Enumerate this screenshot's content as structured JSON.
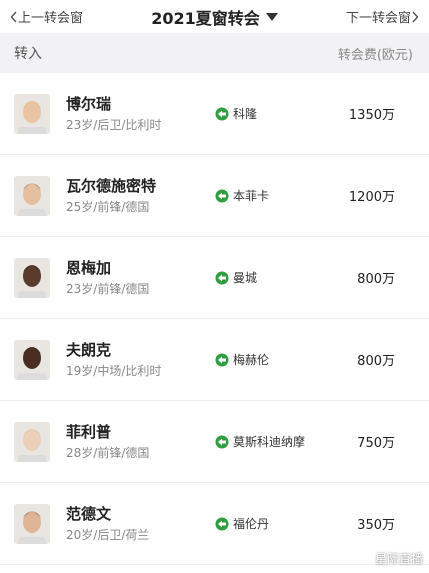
{
  "topbar": {
    "prev_label": "上一转会窗",
    "title": "2021夏窗转会",
    "next_label": "下一转会窗"
  },
  "header": {
    "left_label": "转入",
    "right_label": "转会费(欧元)"
  },
  "players": [
    {
      "name": "博尔瑞",
      "meta": "23岁/后卫/比利时",
      "club": "科隆",
      "fee": "1350万",
      "skin": "#e9c3a2",
      "hair": "#d9b56a"
    },
    {
      "name": "瓦尔德施密特",
      "meta": "25岁/前锋/德国",
      "club": "本菲卡",
      "fee": "1200万",
      "skin": "#e6bf9f",
      "hair": "#7a5a3a"
    },
    {
      "name": "恩梅加",
      "meta": "23岁/前锋/德国",
      "club": "曼城",
      "fee": "800万",
      "skin": "#5a3a28",
      "hair": "#1a1a1a"
    },
    {
      "name": "夫朗克",
      "meta": "19岁/中场/比利时",
      "club": "梅赫伦",
      "fee": "800万",
      "skin": "#4a2e22",
      "hair": "#111111"
    },
    {
      "name": "菲利普",
      "meta": "28岁/前锋/德国",
      "club": "莫斯科迪纳摩",
      "fee": "750万",
      "skin": "#ead0b8",
      "hair": "#c9b08a"
    },
    {
      "name": "范德文",
      "meta": "20岁/后卫/荷兰",
      "club": "福伦丹",
      "fee": "350万",
      "skin": "#dfb595",
      "hair": "#5a4030"
    }
  ],
  "watermark": "星际直播",
  "colors": {
    "transfer_arrow": "#2e9e3f",
    "header_bg": "#f2f2f4"
  },
  "icons": {
    "prev": "chevron-left-icon",
    "next": "chevron-right-icon",
    "dropdown": "caret-down-icon",
    "transfer": "transfer-in-arrow-icon"
  }
}
